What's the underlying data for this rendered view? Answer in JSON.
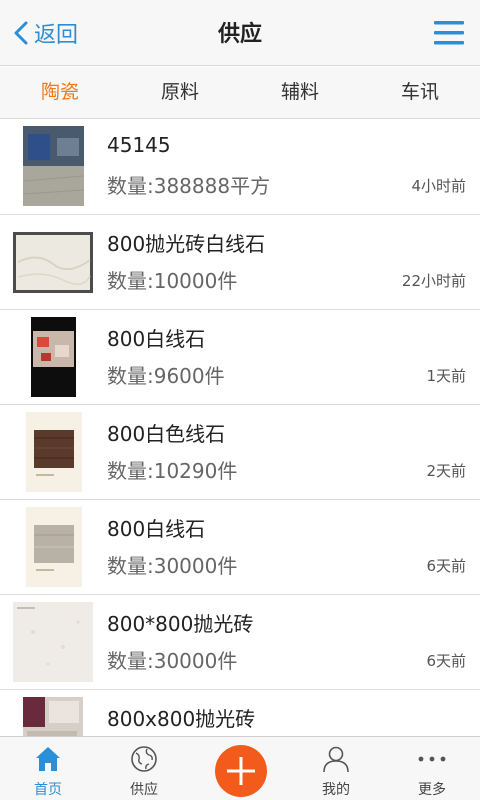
{
  "header": {
    "back_label": "返回",
    "title": "供应"
  },
  "tabs": [
    {
      "label": "陶瓷",
      "active": true
    },
    {
      "label": "原料",
      "active": false
    },
    {
      "label": "辅料",
      "active": false
    },
    {
      "label": "车讯",
      "active": false
    }
  ],
  "items": [
    {
      "name": "45145",
      "qty": "数量:388888平方",
      "time": "4小时前"
    },
    {
      "name": "800抛光砖白线石",
      "qty": "数量:10000件",
      "time": "22小时前"
    },
    {
      "name": "800白线石",
      "qty": "数量:9600件",
      "time": "1天前"
    },
    {
      "name": "800白色线石",
      "qty": "数量:10290件",
      "time": "2天前"
    },
    {
      "name": "800白线石",
      "qty": "数量:30000件",
      "time": "6天前"
    },
    {
      "name": "800*800抛光砖",
      "qty": "数量:30000件",
      "time": "6天前"
    },
    {
      "name": "800x800抛光砖",
      "qty": "",
      "time": ""
    }
  ],
  "bottom_nav": [
    {
      "label": "首页",
      "icon": "home-icon",
      "active": true
    },
    {
      "label": "供应",
      "icon": "globe-icon",
      "active": false
    },
    {
      "label": "",
      "icon": "plus-icon",
      "active": false
    },
    {
      "label": "我的",
      "icon": "user-icon",
      "active": false
    },
    {
      "label": "更多",
      "icon": "more-icon",
      "active": false
    }
  ],
  "colors": {
    "accent": "#2a8fd6",
    "active_tab": "#f07a18",
    "plus_button": "#f35b1d"
  }
}
